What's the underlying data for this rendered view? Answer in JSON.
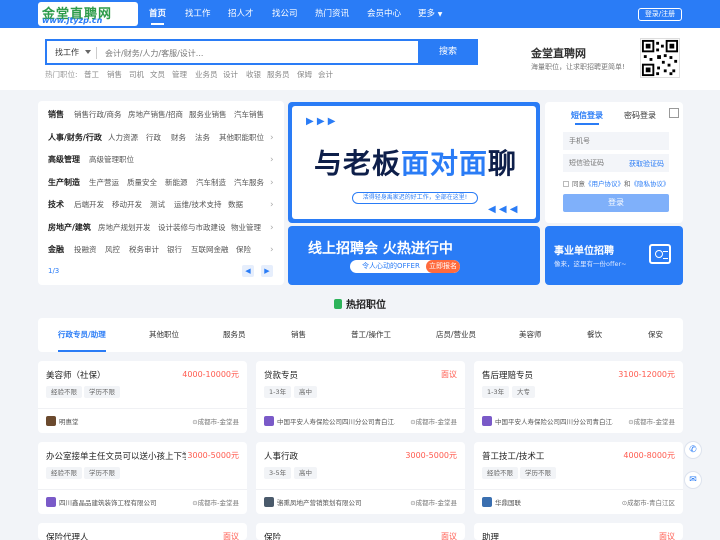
{
  "header": {
    "logo_line1": "金堂直聘网",
    "logo_line2": "www.jtyzp.cn",
    "nav": [
      "首页",
      "找工作",
      "招人才",
      "找公司",
      "热门资讯",
      "会员中心",
      "更多"
    ],
    "login_register": "登录/注册"
  },
  "search": {
    "type": "找工作",
    "placeholder": "会计/财务/人力/客服/设计...",
    "button": "搜索",
    "hot_label": "热门职位:",
    "hot_words": [
      "普工",
      "销售",
      "司机",
      "文员",
      "管理",
      "业务员",
      "设计",
      "收银",
      "服务员",
      "保姆",
      "会计"
    ]
  },
  "brand": {
    "title": "金堂直聘网",
    "subtitle": "海量职位，让求职招聘更简单!"
  },
  "categories": {
    "rows": [
      {
        "name": "销售",
        "items": [
          "销售行政/商务",
          "房地产销售/招商",
          "服务业销售",
          "汽车销售"
        ]
      },
      {
        "name": "人事/财务/行政",
        "items": [
          "人力资源",
          "行政",
          "财务",
          "法务",
          "其他职能职位"
        ]
      },
      {
        "name": "高级管理",
        "items": [
          "高级管理职位"
        ]
      },
      {
        "name": "生产制造",
        "items": [
          "生产营运",
          "质量安全",
          "新能源",
          "汽车制造",
          "汽车服务"
        ]
      },
      {
        "name": "技术",
        "items": [
          "后端开发",
          "移动开发",
          "测试",
          "运维/技术支持",
          "数据"
        ]
      },
      {
        "name": "房地产/建筑",
        "items": [
          "房地产规划开发",
          "设计装修与市政建设",
          "物业管理"
        ]
      },
      {
        "name": "金融",
        "items": [
          "投融资",
          "风控",
          "税务审计",
          "银行",
          "互联网金融",
          "保险"
        ]
      }
    ],
    "page": "1/3",
    "prev": "◀",
    "next": "▶"
  },
  "banner_main": {
    "text_a": "与老板",
    "text_b": "面对面",
    "text_c": "聊",
    "subline": "活得轻身禹家迟的好工作，全部在这里!",
    "deco_left": "▶ ▶ ▶",
    "deco_right": "◀ ◀ ◀"
  },
  "banner_fair": {
    "title": "线上招聘会 火热进行中",
    "pill_text": "令人心动的OFFER",
    "pill_button": "立即报名"
  },
  "login": {
    "tab_sms": "短信登录",
    "tab_pwd": "密码登录",
    "phone_placeholder": "手机号",
    "code_placeholder": "短信验证码",
    "get_code": "获取验证码",
    "agree_prefix": "同意",
    "agreement1": "《用户协议》",
    "and": "和",
    "agreement2": "《隐私协议》",
    "button": "登录"
  },
  "banner_gov": {
    "title": "事业单位招聘",
    "subtitle": "像来，这里有一份offer~"
  },
  "section": {
    "title": "热招职位",
    "tabs": [
      "行政专员/助理",
      "其他职位",
      "服务员",
      "销售",
      "普工/操作工",
      "店员/营业员",
      "美容师",
      "餐饮",
      "保安"
    ]
  },
  "jobs": [
    {
      "title": "美容师（社保）",
      "salary": "4000-10000元",
      "tags": [
        "经验不限",
        "学历不限"
      ],
      "company": "明惠堂",
      "location": "成都市-金堂县",
      "logo_color": "#6b4a2e"
    },
    {
      "title": "贷款专员",
      "salary": "面议",
      "tags": [
        "1-3年",
        "高中"
      ],
      "company": "中国平安人寿保险公司四川分公司青白江...",
      "location": "成都市-金堂县",
      "logo_color": "#7a5ac8"
    },
    {
      "title": "售后理赔专员",
      "salary": "3100-12000元",
      "tags": [
        "1-3年",
        "大专"
      ],
      "company": "中国平安人寿保险公司四川分公司青白江...",
      "location": "成都市-金堂县",
      "logo_color": "#7a5ac8"
    },
    {
      "title": "办公室接单主任文员可以送小孩上下学",
      "salary": "3000-5000元",
      "tags": [
        "经验不限",
        "学历不限"
      ],
      "company": "四川鑫晶品建筑装饰工程有限公司",
      "location": "成都市-金堂县",
      "logo_color": "#7a5ac8"
    },
    {
      "title": "人事行政",
      "salary": "3000-5000元",
      "tags": [
        "3-5年",
        "高中"
      ],
      "company": "骆熏凤地产营销策划有限公司",
      "location": "成都市-金堂县",
      "logo_color": "#4a5a6b"
    },
    {
      "title": "普工技工/技术工",
      "salary": "4000-8000元",
      "tags": [
        "经验不限",
        "学历不限"
      ],
      "company": "华鼎国联",
      "location": "成都市-青白江区",
      "logo_color": "#3a6fb0"
    },
    {
      "title": "保险代理人",
      "salary": "面议",
      "tags": [],
      "company": "",
      "location": "",
      "logo_color": "#7a5ac8"
    },
    {
      "title": "保险",
      "salary": "面议",
      "tags": [],
      "company": "",
      "location": "",
      "logo_color": "#7a5ac8"
    },
    {
      "title": "助理",
      "salary": "面议",
      "tags": [],
      "company": "",
      "location": "",
      "logo_color": "#7a5ac8"
    }
  ],
  "side": {
    "phone_icon": "✆",
    "chat_icon": "✉"
  }
}
